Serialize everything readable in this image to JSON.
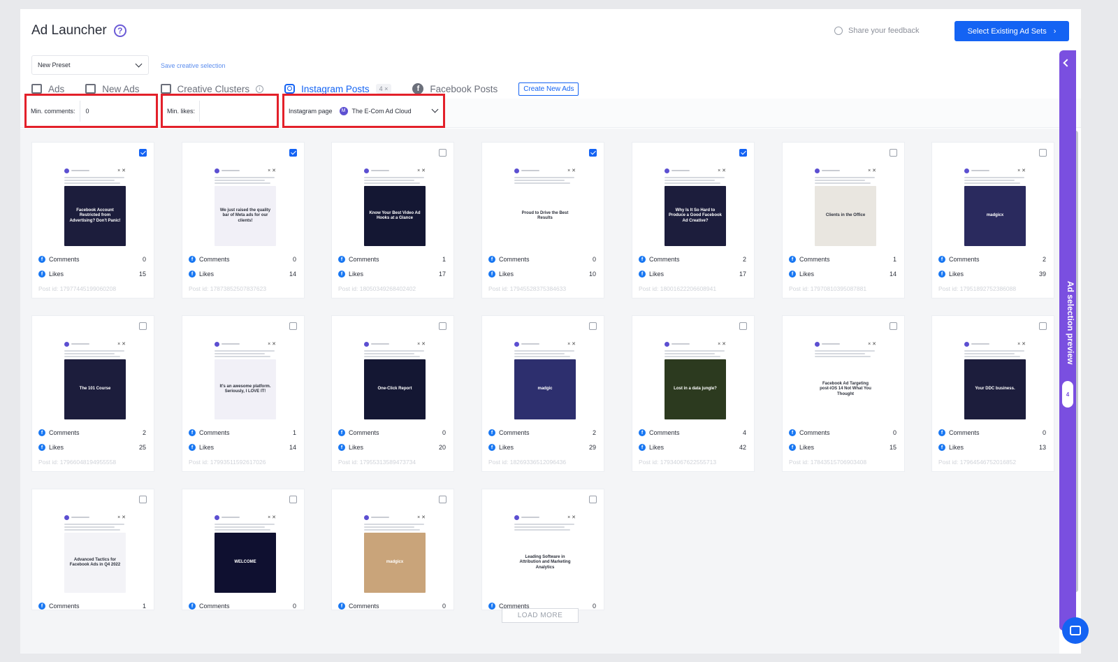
{
  "header": {
    "title": "Ad Launcher",
    "help_icon": "?",
    "feedback_label": "Share your feedback",
    "select_existing_label": "Select Existing Ad Sets"
  },
  "preset": {
    "value": "New Preset",
    "save_link": "Save creative selection"
  },
  "tabs": [
    {
      "label": "Ads"
    },
    {
      "label": "New Ads"
    },
    {
      "label": "Creative Clusters"
    },
    {
      "label": "Instagram Posts",
      "count": "4"
    },
    {
      "label": "Facebook Posts"
    }
  ],
  "create_new_ads_label": "Create New Ads",
  "filters": {
    "min_comments_label": "Min. comments:",
    "min_comments_value": "0",
    "min_likes_label": "Min. likes:",
    "min_likes_value": "",
    "instagram_page_label": "Instagram page",
    "instagram_page_value": "The E-Com Ad Cloud",
    "instagram_page_avatar": "M"
  },
  "stat_labels": {
    "comments": "Comments",
    "likes": "Likes",
    "post_id_prefix": "Post id: "
  },
  "posts": [
    {
      "comments": "0",
      "likes": "15",
      "post_id": "17977445199060208",
      "checked": true,
      "bg": "#1c1d3c",
      "fg": "#ffffff",
      "caption": "Facebook Account Restricted from Advertising? Don't Panic!"
    },
    {
      "comments": "0",
      "likes": "14",
      "post_id": "17873852507837623",
      "checked": true,
      "bg": "#f1f0f7",
      "fg": "#2b2f3a",
      "caption": "We just raised the quality bar of Meta ads for our clients!"
    },
    {
      "comments": "1",
      "likes": "17",
      "post_id": "18050349268402402",
      "checked": false,
      "bg": "#141733",
      "fg": "#ffffff",
      "caption": "Know Your Best Video Ad Hooks at a Glance"
    },
    {
      "comments": "0",
      "likes": "10",
      "post_id": "17945528375384633",
      "checked": true,
      "bg": "#ffffff",
      "fg": "#2b2f3a",
      "caption": "Proud to Drive the Best Results"
    },
    {
      "comments": "2",
      "likes": "17",
      "post_id": "18001622206608941",
      "checked": true,
      "bg": "#1c1d3c",
      "fg": "#ffffff",
      "caption": "Why Is It So Hard to Produce a Good Facebook Ad Creative?"
    },
    {
      "comments": "1",
      "likes": "14",
      "post_id": "17970810395087881",
      "checked": false,
      "bg": "#e9e6e0",
      "fg": "#2b2f3a",
      "caption": "Clients in the Office"
    },
    {
      "comments": "2",
      "likes": "39",
      "post_id": "17951892752386088",
      "checked": false,
      "bg": "#2a2a5e",
      "fg": "#ffffff",
      "caption": "madgicx"
    },
    {
      "comments": "2",
      "likes": "25",
      "post_id": "17966048194955558",
      "checked": false,
      "bg": "#1c1d3c",
      "fg": "#ffffff",
      "caption": "The 101 Course"
    },
    {
      "comments": "1",
      "likes": "14",
      "post_id": "17993511592617026",
      "checked": false,
      "bg": "#f1f0f7",
      "fg": "#2b2f3a",
      "caption": "It's an awesome platform. Seriously, I LOVE IT!"
    },
    {
      "comments": "0",
      "likes": "20",
      "post_id": "17955313589473734",
      "checked": false,
      "bg": "#141733",
      "fg": "#ffffff",
      "caption": "One-Click Report"
    },
    {
      "comments": "2",
      "likes": "29",
      "post_id": "18269336512096436",
      "checked": false,
      "bg": "#2d2f6e",
      "fg": "#ffffff",
      "caption": "madgic"
    },
    {
      "comments": "4",
      "likes": "42",
      "post_id": "17934067622555713",
      "checked": false,
      "bg": "#2c3a1f",
      "fg": "#ffffff",
      "caption": "Lost in a data jungle?"
    },
    {
      "comments": "0",
      "likes": "15",
      "post_id": "17843515706903408",
      "checked": false,
      "bg": "#ffffff",
      "fg": "#2b2f3a",
      "caption": "Facebook Ad Targeting post-iOS 14 Not What You Thought"
    },
    {
      "comments": "0",
      "likes": "13",
      "post_id": "17964546752016852",
      "checked": false,
      "bg": "#1c1d3c",
      "fg": "#ffffff",
      "caption": "Your DDC business."
    },
    {
      "comments": "1",
      "likes": "",
      "post_id": "",
      "checked": false,
      "bg": "#f3f3f7",
      "fg": "#2b2f3a",
      "caption": "Advanced Tactics for Facebook Ads in Q4 2022"
    },
    {
      "comments": "0",
      "likes": "",
      "post_id": "",
      "checked": false,
      "bg": "#0f1030",
      "fg": "#ffffff",
      "caption": "WELCOME"
    },
    {
      "comments": "0",
      "likes": "",
      "post_id": "",
      "checked": false,
      "bg": "#c9a47a",
      "fg": "#ffffff",
      "caption": "madgicx"
    },
    {
      "comments": "0",
      "likes": "",
      "post_id": "",
      "checked": false,
      "bg": "#ffffff",
      "fg": "#2b2f3a",
      "caption": "Leading Software in Attribution and Marketing Analytics"
    }
  ],
  "load_more_label": "LOAD MORE",
  "side_panel": {
    "label": "Ad selection preview",
    "count": "4"
  },
  "icons": {
    "help": "help-icon",
    "chat": "chat-icon",
    "facebook": "facebook-icon",
    "instagram": "instagram-icon"
  },
  "colors": {
    "primary": "#1463f3",
    "highlight": "#e3202a",
    "panel": "#7a4fe0",
    "facebook": "#1877f2"
  }
}
